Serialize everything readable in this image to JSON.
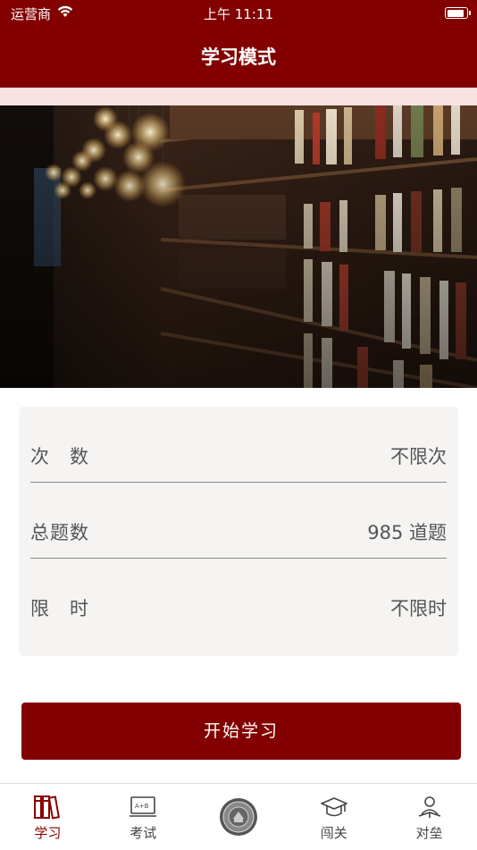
{
  "status_bar": {
    "carrier": "运营商",
    "time": "上午 11:11"
  },
  "header": {
    "title": "学习模式"
  },
  "banner": {
    "description_icon": "library-bookshelf-photo"
  },
  "info": {
    "rows": [
      {
        "label": "次　数",
        "value": "不限次"
      },
      {
        "label": "总题数",
        "value": "985 道题"
      },
      {
        "label": "限　时",
        "value": "不限时"
      }
    ]
  },
  "start_button": {
    "label": "开始学习"
  },
  "tabbar": {
    "items": [
      {
        "label": "学习",
        "icon": "books-icon",
        "active": true
      },
      {
        "label": "考试",
        "icon": "exam-board-icon",
        "active": false
      },
      {
        "label": "",
        "icon": "emblem-icon",
        "active": false
      },
      {
        "label": "闯关",
        "icon": "graduation-cap-icon",
        "active": false
      },
      {
        "label": "对垒",
        "icon": "reading-person-icon",
        "active": false
      }
    ]
  },
  "colors": {
    "primary": "#820000",
    "accent_bg": "#fbe2e2",
    "card_bg": "#f5f4f2"
  }
}
